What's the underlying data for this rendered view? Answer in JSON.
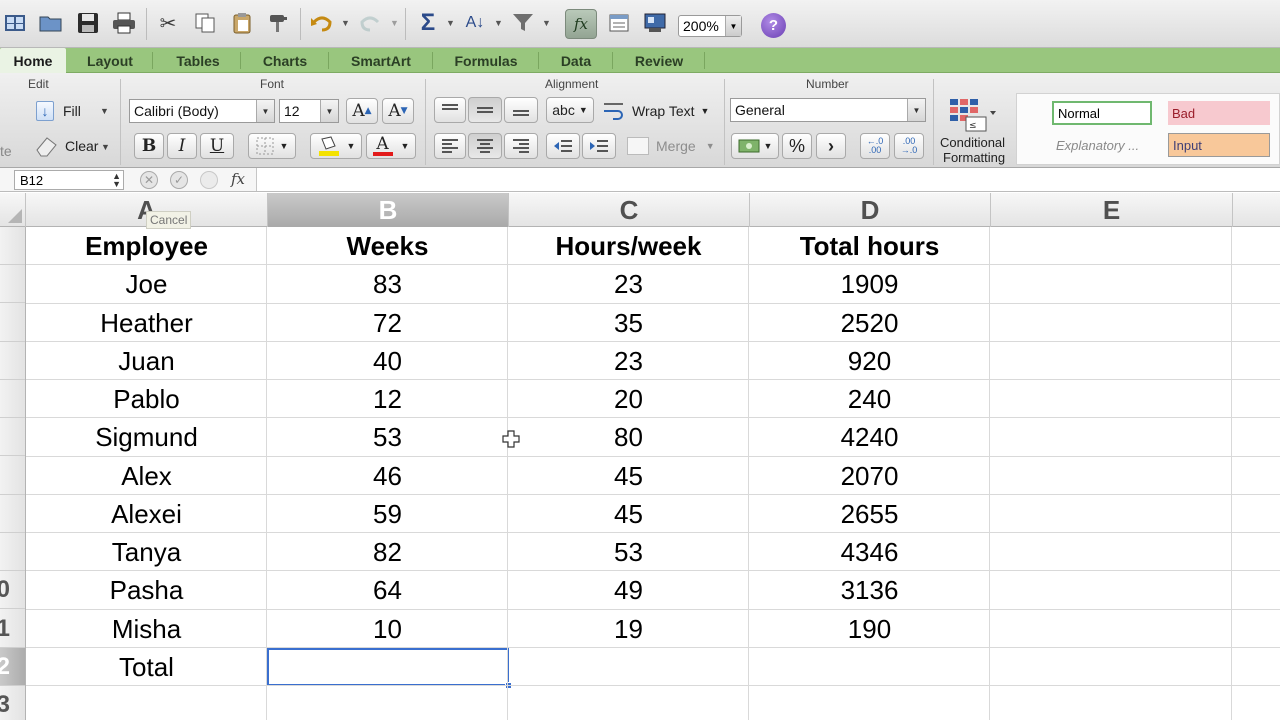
{
  "toolbar": {
    "zoom": "200%",
    "icons": [
      "gallery-icon",
      "open-icon",
      "save-icon",
      "print-icon",
      "cut-icon",
      "copy-icon",
      "paste-icon",
      "format-painter-icon",
      "undo-icon",
      "redo-icon",
      "autosum-icon",
      "sort-icon",
      "filter-icon",
      "formula-builder-icon",
      "toolbox-icon",
      "media-browser-icon",
      "help-icon"
    ]
  },
  "ribbon_tabs": [
    "Home",
    "Layout",
    "Tables",
    "Charts",
    "SmartArt",
    "Formulas",
    "Data",
    "Review"
  ],
  "ribbon": {
    "groups": {
      "edit": "Edit",
      "font": "Font",
      "alignment": "Alignment",
      "number": "Number"
    },
    "fill_label": "Fill",
    "clear_label": "Clear",
    "paste_partial": "te",
    "font_name": "Calibri (Body)",
    "font_size": "12",
    "bold": "B",
    "italic": "I",
    "underline": "U",
    "font_color_letter": "A",
    "grow_font": "A",
    "shrink_font": "A",
    "wrap_text": "Wrap Text",
    "abc": "abc",
    "merge": "Merge",
    "number_format": "General",
    "percent": "%",
    "comma": "›",
    "inc_decimal": "←.0 .00",
    "dec_decimal": ".00 →.0",
    "conditional_formatting_line1": "Conditional",
    "conditional_formatting_line2": "Formatting",
    "styles": {
      "normal": "Normal",
      "bad": "Bad",
      "explanatory": "Explanatory ...",
      "input": "Input"
    }
  },
  "formula_bar": {
    "name_box": "B12",
    "fx": "fx",
    "value": ""
  },
  "tooltip": "Cancel",
  "columns": [
    "A",
    "B",
    "C",
    "D",
    "E"
  ],
  "selected_column": "B",
  "rows": [
    "",
    "",
    "",
    "",
    "",
    "",
    "",
    "",
    "",
    "0",
    "1",
    "2",
    "3"
  ],
  "selected_row_index": 11,
  "table": {
    "headers": [
      "Employee",
      "Weeks",
      "Hours/week",
      "Total hours"
    ],
    "data": [
      [
        "Joe",
        "83",
        "23",
        "1909"
      ],
      [
        "Heather",
        "72",
        "35",
        "2520"
      ],
      [
        "Juan",
        "40",
        "23",
        "920"
      ],
      [
        "Pablo",
        "12",
        "20",
        "240"
      ],
      [
        "Sigmund",
        "53",
        "80",
        "4240"
      ],
      [
        "Alex",
        "46",
        "45",
        "2070"
      ],
      [
        "Alexei",
        "59",
        "45",
        "2655"
      ],
      [
        "Tanya",
        "82",
        "53",
        "4346"
      ],
      [
        "Pasha",
        "64",
        "49",
        "3136"
      ],
      [
        "Misha",
        "10",
        "19",
        "190"
      ]
    ],
    "total_label": "Total"
  },
  "colors": {
    "ribbon_tab_bar": "#99c67e",
    "selection": "#3a6fcf",
    "style_bad_bg": "#f7c9cf",
    "style_input_bg": "#f8c89a"
  }
}
